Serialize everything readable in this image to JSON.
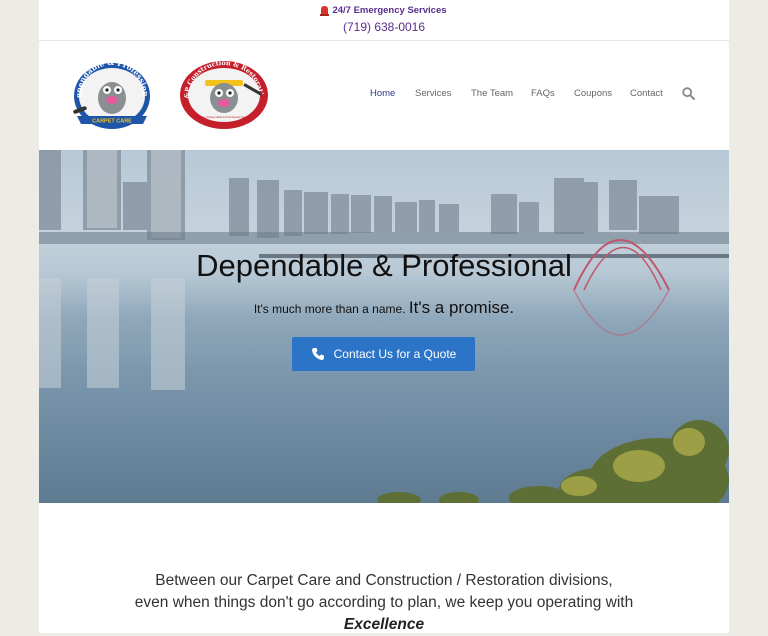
{
  "topbar": {
    "emergency": "24/7 Emergency Services",
    "phone": "(719) 638-0016"
  },
  "logos": {
    "carpet_care": {
      "arc_text": "Dependable & Professional",
      "ribbon_text": "CARPET CARE"
    },
    "construction": {
      "arc_text": "D&P Construction & Restoration",
      "ribbon_text": "A Division of Dependable & Professional Carpet Care"
    }
  },
  "nav": {
    "items": [
      "Home",
      "Services",
      "The Team",
      "FAQs",
      "Coupons",
      "Contact"
    ],
    "active": "Home"
  },
  "hero": {
    "title": "Dependable & Professional",
    "sub_small": "It's much more than a name.",
    "sub_big": "It's a promise.",
    "cta": "Contact Us for a Quote"
  },
  "intro": {
    "line1": "Between our Carpet Care and Construction / Restoration divisions,",
    "line2": "even when things don't go according to plan, we keep you operating with",
    "emphasis": "Excellence"
  },
  "colors": {
    "brand_purple": "#5b2d8e",
    "nav_active": "#2a3a88",
    "cta_blue": "#2b74c7"
  }
}
